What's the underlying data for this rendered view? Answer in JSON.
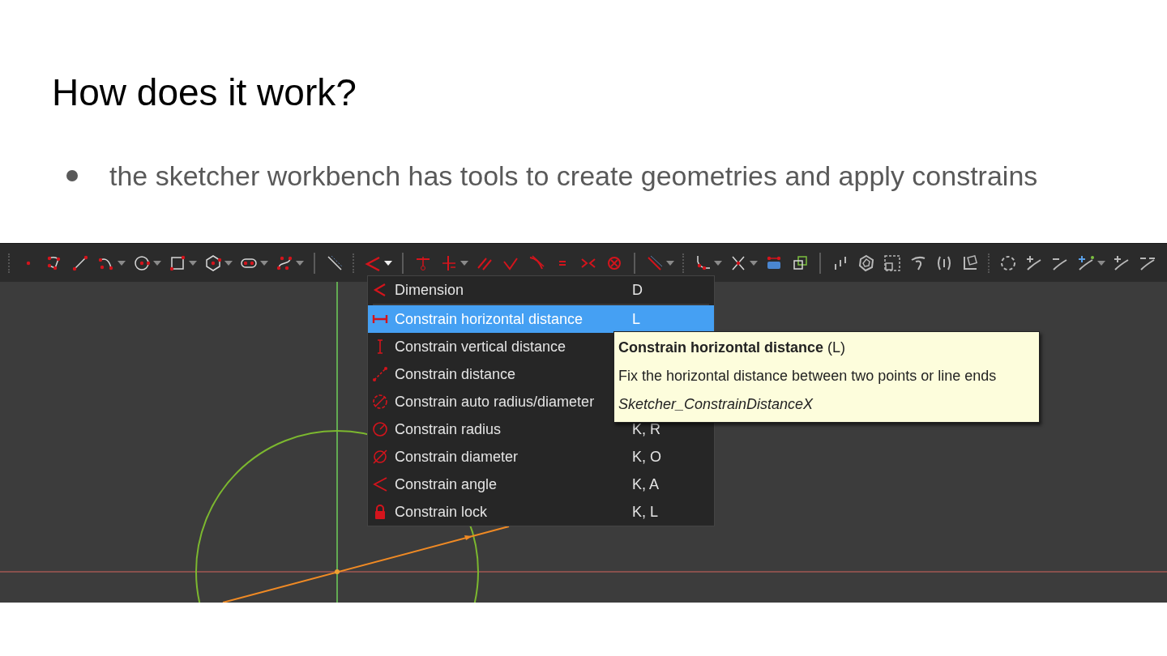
{
  "slide": {
    "title": "How does it work?",
    "bullets": [
      "the sketcher workbench has tools to create geometries and apply constrains"
    ]
  },
  "menu": {
    "items": [
      {
        "label": "Dimension",
        "shortcut": "D",
        "selected": false
      },
      {
        "label": "Constrain horizontal distance",
        "shortcut": "L",
        "selected": true
      },
      {
        "label": "Constrain vertical distance",
        "selected": false
      },
      {
        "label": "Constrain distance",
        "selected": false
      },
      {
        "label": "Constrain auto radius/diameter",
        "selected": false
      },
      {
        "label": "Constrain radius",
        "shortcut": "K, R",
        "selected": false
      },
      {
        "label": "Constrain diameter",
        "shortcut": "K, O",
        "selected": false
      },
      {
        "label": "Constrain angle",
        "shortcut": "K, A",
        "selected": false
      },
      {
        "label": "Constrain lock",
        "shortcut": "K, L",
        "selected": false
      }
    ]
  },
  "tooltip": {
    "title": "**Constrain horizontal distance** (L)",
    "description": "Fix the horizontal distance between two points or line ends",
    "command": "Sketcher_ConstrainDistanceX"
  }
}
